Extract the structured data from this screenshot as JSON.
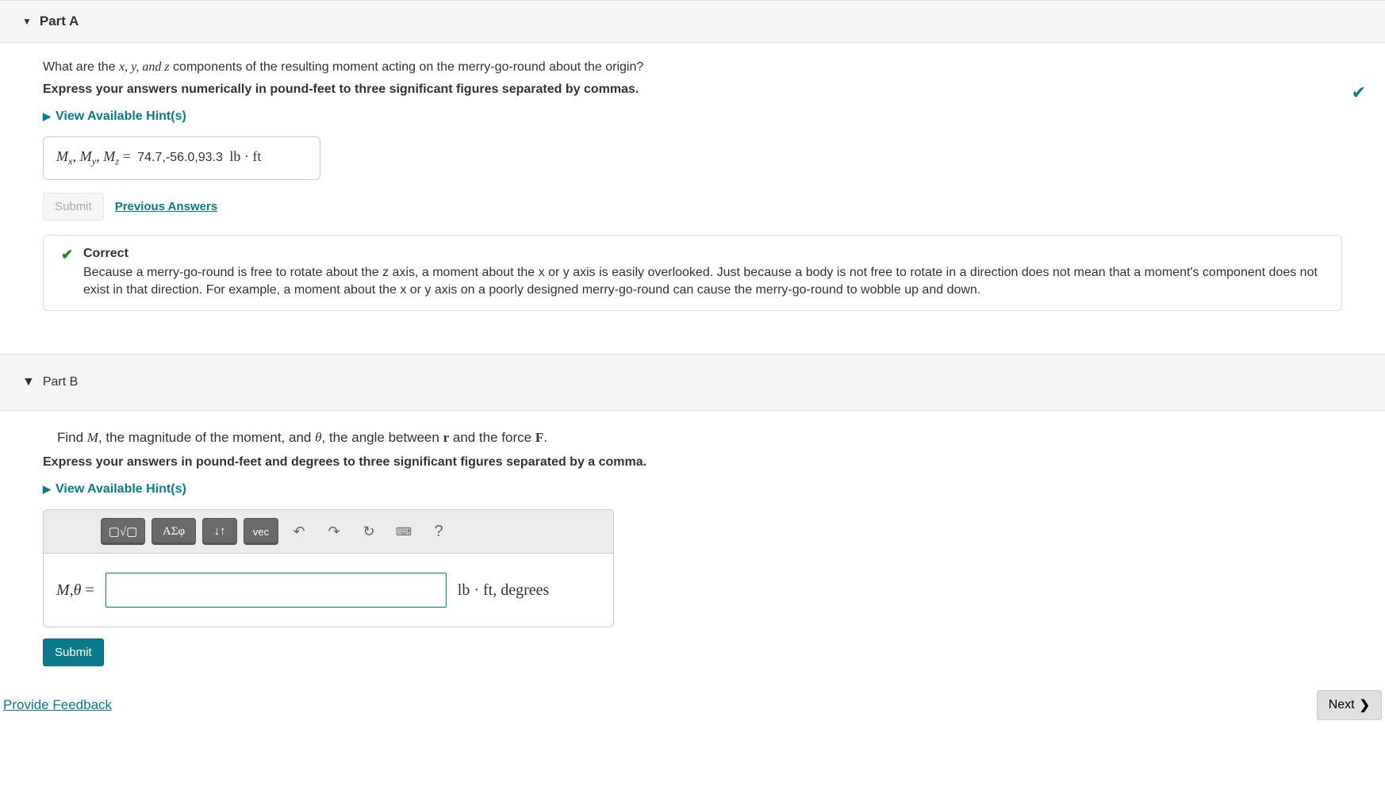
{
  "partA": {
    "title": "Part A",
    "question_pre": "What are the ",
    "question_vars": "x, y, and z",
    "question_post": " components of the resulting moment acting on the merry-go-round about the origin?",
    "instruction": "Express your answers numerically in pound-feet to three significant figures separated by commas.",
    "hints_label": "View Available Hint(s)",
    "answer_prefix_mx": "M",
    "answer_prefix_sx": "x",
    "answer_prefix_my": "M",
    "answer_prefix_sy": "y",
    "answer_prefix_mz": "M",
    "answer_prefix_sz": "z",
    "answer_eq": " = ",
    "answer_value": "74.7,-56.0,93.3",
    "answer_units": " lb · ft",
    "submit_label": "Submit",
    "prev_answers_label": "Previous Answers",
    "feedback_title": "Correct",
    "feedback_text": "Because a merry-go-round is free to rotate about the z axis, a moment about the x or y axis is easily overlooked. Just because a body is not free to rotate in a direction does not mean that a moment's component does not exist in that direction. For example, a moment about the x or y axis on a poorly designed merry-go-round can cause the merry-go-round to wobble up and down."
  },
  "partB": {
    "title": "Part B",
    "q_pre": "Find ",
    "q_M": "M",
    "q_mid1": ", the magnitude of the moment, and ",
    "q_theta": "θ",
    "q_mid2": ", the angle between ",
    "q_r": "r",
    "q_mid3": " and the force ",
    "q_F": "F",
    "q_end": ".",
    "instruction": "Express your answers in pound-feet and degrees to three significant figures separated by a comma.",
    "hints_label": "View Available Hint(s)",
    "toolbar": {
      "templates": "▢√▢",
      "greek": "ΑΣφ",
      "subsup": "↓↑",
      "vec": "vec",
      "undo": "↶",
      "redo": "↷",
      "reset": "↻",
      "keyboard": "⌨",
      "help": "?"
    },
    "input_label_M": "M",
    "input_label_comma": ",",
    "input_label_theta": "θ",
    "input_label_eq": " = ",
    "input_value": "",
    "units": "lb · ft, degrees",
    "submit_label": "Submit"
  },
  "footer": {
    "feedback_link": "Provide Feedback",
    "next_label": "Next"
  }
}
